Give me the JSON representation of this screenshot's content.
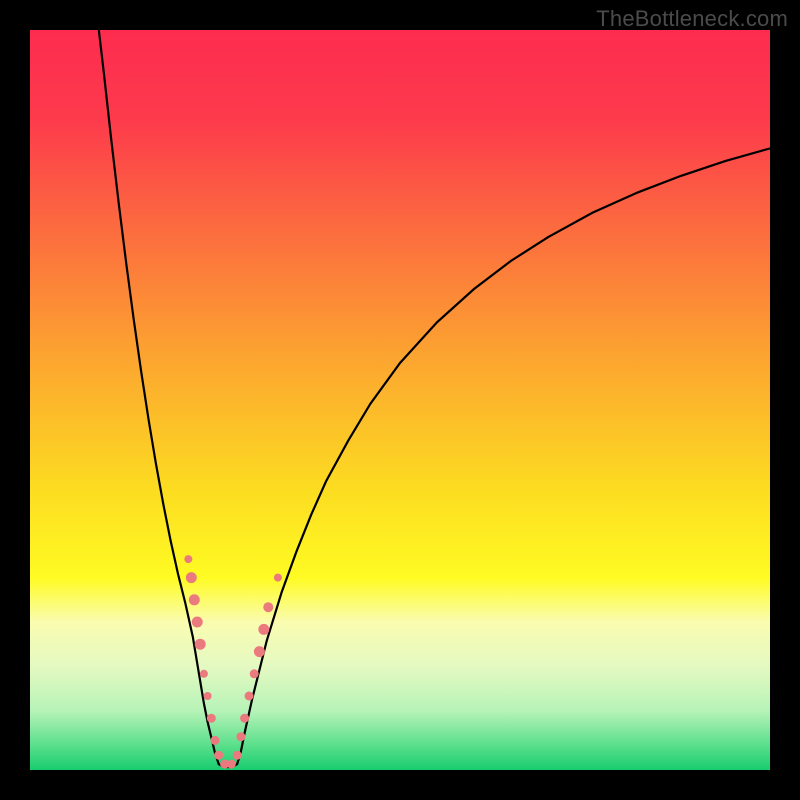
{
  "watermark": "TheBottleneck.com",
  "colors": {
    "frame": "#000000",
    "gradient_stops": [
      {
        "offset": 0.0,
        "color": "#fd2c4f"
      },
      {
        "offset": 0.12,
        "color": "#fd3a4c"
      },
      {
        "offset": 0.28,
        "color": "#fc6f3e"
      },
      {
        "offset": 0.45,
        "color": "#fca72f"
      },
      {
        "offset": 0.62,
        "color": "#fcdc21"
      },
      {
        "offset": 0.74,
        "color": "#fffb23"
      },
      {
        "offset": 0.8,
        "color": "#fafcb0"
      },
      {
        "offset": 0.86,
        "color": "#e4f9c2"
      },
      {
        "offset": 0.92,
        "color": "#b7f3b7"
      },
      {
        "offset": 0.965,
        "color": "#5de08d"
      },
      {
        "offset": 1.0,
        "color": "#18cc6e"
      }
    ],
    "marker": "#eb7a7e",
    "curve": "#000000"
  },
  "chart_data": {
    "type": "line",
    "title": "",
    "xlabel": "",
    "ylabel": "",
    "xlim": [
      0,
      100
    ],
    "ylim": [
      0,
      100
    ],
    "grid": false,
    "legend": false,
    "series": [
      {
        "name": "left_branch",
        "x": [
          9.3,
          10,
          11,
          12,
          13,
          14,
          15,
          16,
          17,
          18,
          19,
          20,
          21,
          22,
          23,
          23.5,
          24,
          25,
          25.5
        ],
        "y": [
          100,
          94,
          85,
          76.5,
          68.5,
          61,
          54,
          47.5,
          41.5,
          36,
          31,
          26.5,
          22.5,
          18,
          12,
          9,
          6.5,
          2.3,
          0.8
        ]
      },
      {
        "name": "bottom",
        "x": [
          25.5,
          26,
          26.5,
          27,
          27.5,
          28
        ],
        "y": [
          0.8,
          0.5,
          0.4,
          0.4,
          0.5,
          0.8
        ]
      },
      {
        "name": "right_branch",
        "x": [
          28,
          28.5,
          29,
          30,
          31,
          32,
          34,
          36,
          38,
          40,
          43,
          46,
          50,
          55,
          60,
          65,
          70,
          76,
          82,
          88,
          94,
          100
        ],
        "y": [
          0.8,
          2.5,
          5,
          9.5,
          13.5,
          17.5,
          24,
          29.5,
          34.5,
          39,
          44.5,
          49.5,
          55,
          60.5,
          65,
          68.8,
          72,
          75.3,
          78,
          80.3,
          82.3,
          84
        ]
      }
    ],
    "markers": [
      {
        "x": 21.4,
        "y": 28.5,
        "r": 4.0
      },
      {
        "x": 21.8,
        "y": 26.0,
        "r": 5.5
      },
      {
        "x": 22.2,
        "y": 23.0,
        "r": 5.5
      },
      {
        "x": 22.6,
        "y": 20.0,
        "r": 5.5
      },
      {
        "x": 23.0,
        "y": 17.0,
        "r": 5.5
      },
      {
        "x": 23.5,
        "y": 13.0,
        "r": 4.0
      },
      {
        "x": 24.0,
        "y": 10.0,
        "r": 4.0
      },
      {
        "x": 24.5,
        "y": 7.0,
        "r": 4.5
      },
      {
        "x": 25.0,
        "y": 4.0,
        "r": 4.5
      },
      {
        "x": 25.5,
        "y": 2.0,
        "r": 4.5
      },
      {
        "x": 26.3,
        "y": 0.8,
        "r": 4.5
      },
      {
        "x": 27.2,
        "y": 0.8,
        "r": 4.5
      },
      {
        "x": 28.0,
        "y": 2.0,
        "r": 4.5
      },
      {
        "x": 28.5,
        "y": 4.5,
        "r": 4.5
      },
      {
        "x": 29.0,
        "y": 7.0,
        "r": 4.5
      },
      {
        "x": 29.6,
        "y": 10.0,
        "r": 4.5
      },
      {
        "x": 30.3,
        "y": 13.0,
        "r": 4.5
      },
      {
        "x": 31.0,
        "y": 16.0,
        "r": 5.5
      },
      {
        "x": 31.6,
        "y": 19.0,
        "r": 5.5
      },
      {
        "x": 32.2,
        "y": 22.0,
        "r": 5.0
      },
      {
        "x": 33.5,
        "y": 26.0,
        "r": 4.0
      }
    ]
  }
}
